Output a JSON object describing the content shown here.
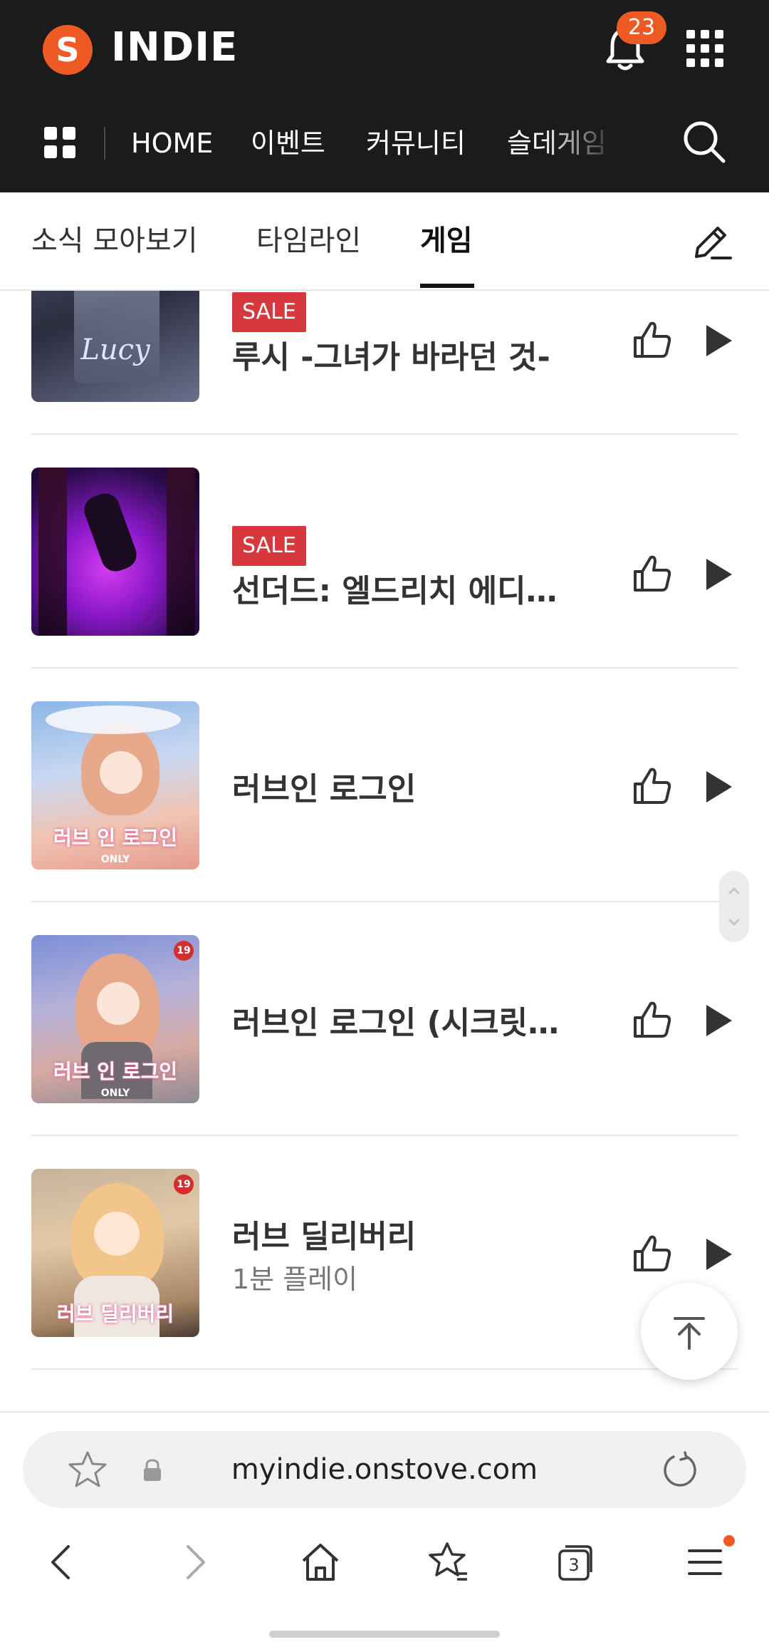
{
  "header": {
    "logo_letter": "S",
    "brand": "INDIE",
    "notification_count": "23",
    "nav": [
      "HOME",
      "이벤트",
      "커뮤니티",
      "슬데게임"
    ]
  },
  "subtabs": {
    "items": [
      "소식 모아보기",
      "타임라인",
      "게임"
    ],
    "active": "게임"
  },
  "games": [
    {
      "sale": "SALE",
      "title": "루시 -그녀가 바라던 것-",
      "thumb_text": "Lucy"
    },
    {
      "sale": "SALE",
      "title": "선더드: 엘드리치 에디…"
    },
    {
      "title": "러브인 로그인",
      "thumb_text": "러브 인 로그인",
      "thumb_badge": "ONLY"
    },
    {
      "title": "러브인 로그인 (시크릿 …",
      "thumb_text": "러브 인 로그인",
      "thumb_badge": "ONLY",
      "age": "19"
    },
    {
      "title": "러브 딜리버리",
      "subtitle": "1분 플레이",
      "thumb_text": "러브 딜리버리",
      "age": "19"
    }
  ],
  "browser": {
    "url": "myindie.onstove.com",
    "tab_count": "3"
  },
  "colors": {
    "accent": "#ee5a24",
    "sale": "#d7383d",
    "header_bg": "#1b1b1b"
  }
}
